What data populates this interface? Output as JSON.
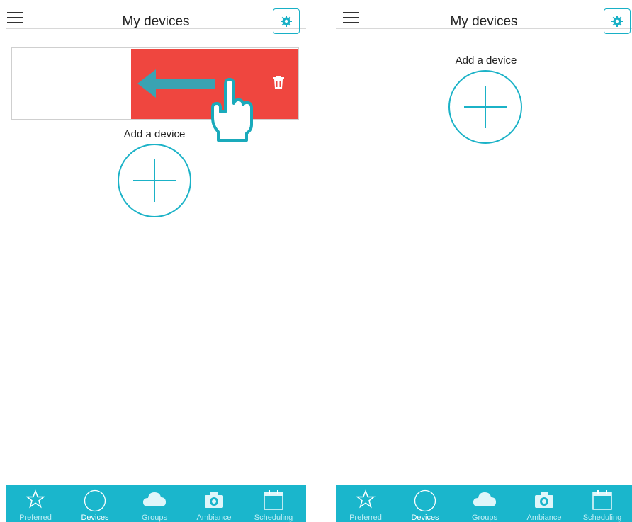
{
  "header": {
    "title": "My devices"
  },
  "add_device": {
    "label": "Add a device"
  },
  "tabs": [
    {
      "label": "Preferred",
      "icon": "star-icon"
    },
    {
      "label": "Devices",
      "icon": "circle-icon",
      "active": true
    },
    {
      "label": "Groups",
      "icon": "cloud-icon"
    },
    {
      "label": "Ambiance",
      "icon": "camera-icon"
    },
    {
      "label": "Scheduling",
      "icon": "calendar-icon"
    }
  ],
  "colors": {
    "accent": "#1ab6cc",
    "delete": "#ef463f",
    "tab_text": "#bfeef5"
  }
}
